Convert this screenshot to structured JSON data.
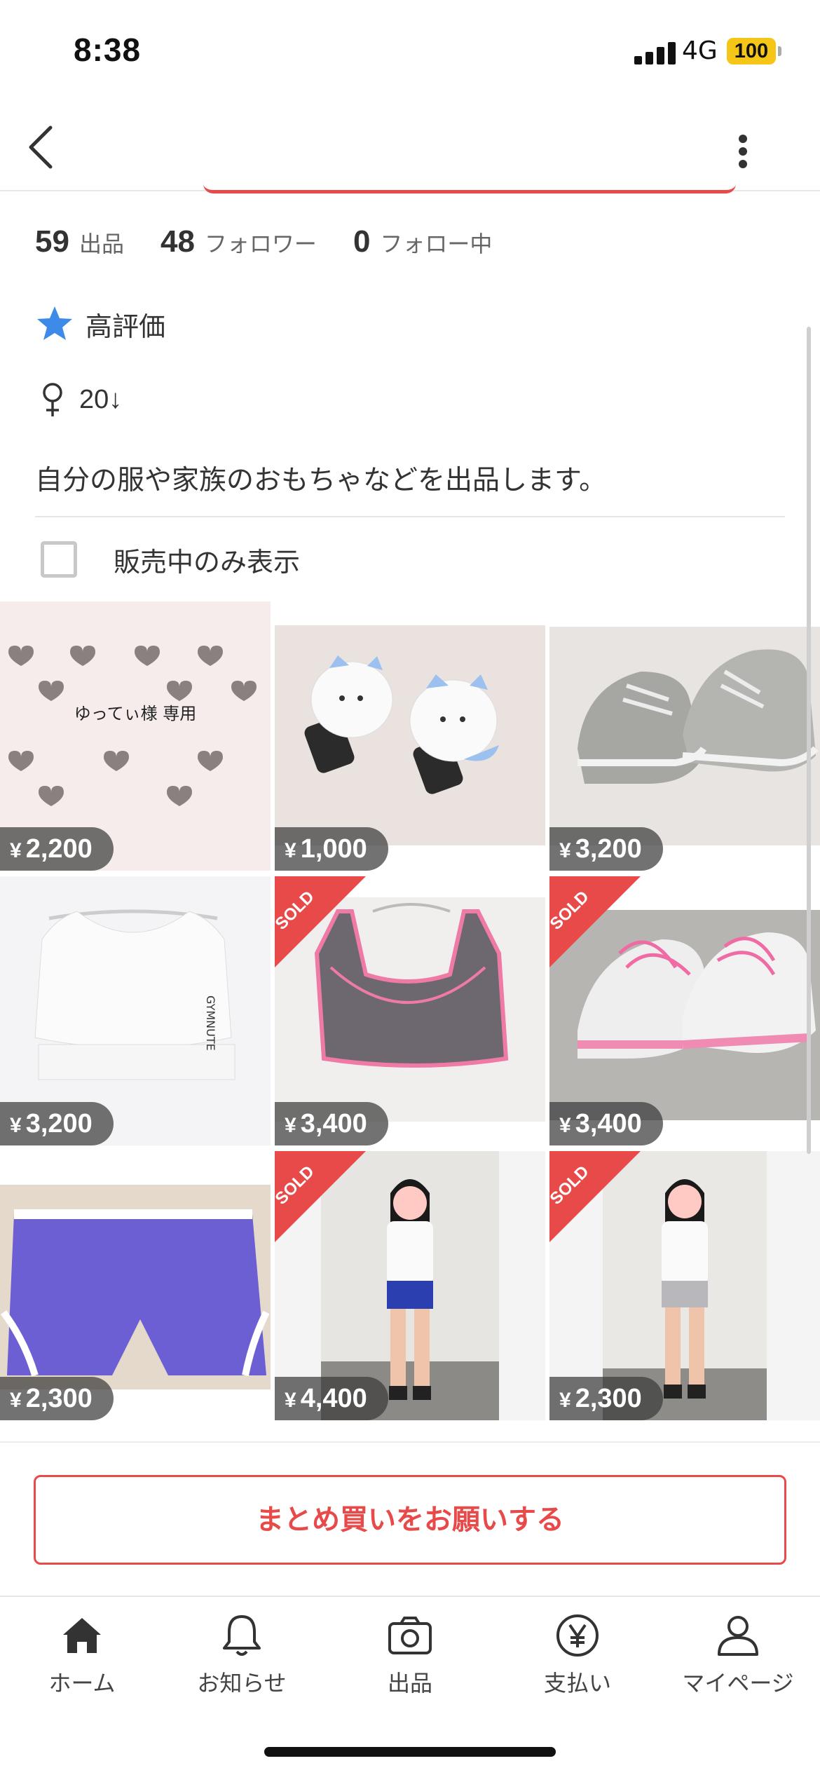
{
  "status_bar": {
    "time": "8:38",
    "network": "4G",
    "battery": "100"
  },
  "nav": {
    "back_icon": "chevron-left-icon",
    "more_icon": "more-vertical-icon"
  },
  "stats": [
    {
      "value": "59",
      "label": "出品"
    },
    {
      "value": "48",
      "label": "フォロワー"
    },
    {
      "value": "0",
      "label": "フォロー中"
    }
  ],
  "rating": {
    "icon": "star-icon",
    "label": "高評価",
    "color": "#3d8ae8"
  },
  "profile": {
    "gender_icon": "female-icon",
    "age": "20↓",
    "bio": "自分の服や家族のおもちゃなどを出品します。"
  },
  "filter": {
    "label": "販売中のみ表示",
    "checked": false
  },
  "items": [
    {
      "price": "2,200",
      "sold": false,
      "caption": "ゆってぃ様 専用"
    },
    {
      "price": "1,000",
      "sold": false
    },
    {
      "price": "3,200",
      "sold": false
    },
    {
      "price": "3,200",
      "sold": false,
      "caption": "GYMNUTE"
    },
    {
      "price": "3,400",
      "sold": true
    },
    {
      "price": "3,400",
      "sold": true
    },
    {
      "price": "2,300",
      "sold": false
    },
    {
      "price": "4,400",
      "sold": true
    },
    {
      "price": "2,300",
      "sold": true
    }
  ],
  "currency_symbol": "¥",
  "sold_label": "SOLD",
  "bundle_button": "まとめ買いをお願いする",
  "tabs": [
    {
      "label": "ホーム",
      "icon": "home-icon"
    },
    {
      "label": "お知らせ",
      "icon": "bell-icon"
    },
    {
      "label": "出品",
      "icon": "camera-icon"
    },
    {
      "label": "支払い",
      "icon": "yen-icon"
    },
    {
      "label": "マイページ",
      "icon": "person-icon"
    }
  ],
  "colors": {
    "accent": "#e84a4a",
    "sold_badge": "#e84a4a"
  }
}
